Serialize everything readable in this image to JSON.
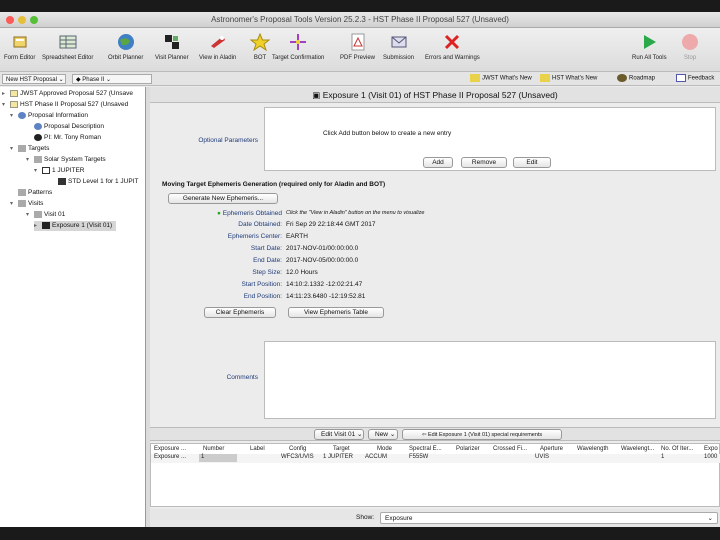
{
  "window": {
    "title": "Astronomer's Proposal Tools Version 25.2.3 - HST Phase II Proposal 527 (Unsaved)"
  },
  "toolbar": {
    "items": [
      {
        "label": "Form Editor",
        "icon": "form-editor-icon"
      },
      {
        "label": "Spreadsheet Editor",
        "icon": "spreadsheet-icon"
      },
      {
        "label": "Orbit Planner",
        "icon": "globe-icon"
      },
      {
        "label": "Visit Planner",
        "icon": "visit-planner-icon"
      },
      {
        "label": "View in Aladin",
        "icon": "aladin-icon"
      },
      {
        "label": "BOT",
        "icon": "star-icon"
      },
      {
        "label": "Target Confirmation",
        "icon": "crosshair-icon"
      },
      {
        "label": "PDF Preview",
        "icon": "pdf-icon"
      },
      {
        "label": "Submission",
        "icon": "submission-icon"
      },
      {
        "label": "Errors and Warnings",
        "icon": "error-x-icon"
      }
    ],
    "run_all": "Run All Tools",
    "stop": "Stop"
  },
  "tabs": {
    "tab1": "New HST Proposal",
    "tab2": "Phase II",
    "links": [
      {
        "label": "JWST What's New",
        "icon": "whats-new-icon"
      },
      {
        "label": "HST What's New",
        "icon": "whats-new-icon"
      },
      {
        "label": "Roadmap",
        "icon": "roadmap-icon"
      },
      {
        "label": "Feedback",
        "icon": "feedback-icon"
      }
    ]
  },
  "tree": {
    "items": [
      {
        "label": "JWST Approved Proposal 527 (Unsave",
        "level": 0,
        "arrow": "▸"
      },
      {
        "label": "HST Phase II Proposal 527 (Unsaved",
        "level": 0,
        "arrow": "▾"
      },
      {
        "label": "Proposal Information",
        "level": 1,
        "arrow": "▾"
      },
      {
        "label": "Proposal Description",
        "level": 2,
        "arrow": ""
      },
      {
        "label": "PI: Mr. Tony Roman",
        "level": 2,
        "arrow": ""
      },
      {
        "label": "Targets",
        "level": 1,
        "arrow": "▾"
      },
      {
        "label": "Solar System Targets",
        "level": 2,
        "arrow": "▾"
      },
      {
        "label": "1 JUPITER",
        "level": 3,
        "arrow": "▾"
      },
      {
        "label": "STD Level 1 for 1 JUPIT",
        "level": 4,
        "arrow": ""
      },
      {
        "label": "Patterns",
        "level": 1,
        "arrow": ""
      },
      {
        "label": "Visits",
        "level": 1,
        "arrow": "▾"
      },
      {
        "label": "Visit 01",
        "level": 2,
        "arrow": "▾"
      },
      {
        "label": "Exposure 1 (Visit 01)",
        "level": 3,
        "arrow": "▸"
      }
    ]
  },
  "main": {
    "header": "Exposure 1 (Visit 01) of HST Phase II Proposal 527 (Unsaved)",
    "optional_parameters_label": "Optional Parameters",
    "params_hint": "Click Add button below to create a new entry",
    "add": "Add",
    "remove": "Remove",
    "edit": "Edit",
    "ephem_section": "Moving Target Ephemeris Generation (required only for Aladin and BOT)",
    "generate": "Generate New Ephemeris...",
    "ephem_obtained_label": "Ephemeris Obtained",
    "ephem_obtained_value": "Click the \"View in Aladin\" button on the menu to visualize",
    "fields": [
      {
        "label": "Date Obtained:",
        "value": "Fri Sep 29 22:18:44 GMT 2017"
      },
      {
        "label": "Ephemeris Center:",
        "value": "EARTH"
      },
      {
        "label": "Start Date:",
        "value": "2017-NOV-01/00:00:00.0"
      },
      {
        "label": "End Date:",
        "value": "2017-NOV-05/00:00:00.0"
      },
      {
        "label": "Step Size:",
        "value": "12.0 Hours"
      },
      {
        "label": "Start Position:",
        "value": "14:10:2.1332 -12:02:21.47"
      },
      {
        "label": "End Position:",
        "value": "14:11:23.6480 -12:19:52.81"
      }
    ],
    "clear": "Clear Ephemeris",
    "view_table": "View Ephemeris Table",
    "comments_label": "Comments"
  },
  "bottom_bar": {
    "edit_visit": "Edit Visit 01",
    "new": "New",
    "special": "Edit Exposure 1 (Visit 01) special requirements"
  },
  "table": {
    "headers": [
      "Exposure ...",
      "Number",
      "Label",
      "Config",
      "Target",
      "Mode",
      "Spectral E...",
      "Polarizer",
      "Crossed Fi...",
      "Aperture",
      "Wavelength",
      "Wavelengt...",
      "No. Of Iter...",
      "Expo"
    ],
    "row": [
      "Exposure ...",
      "1",
      "",
      "WFC3/UVIS",
      "1 JUPITER",
      "ACCUM",
      "F555W",
      "",
      "",
      "UVIS",
      "",
      "",
      "1",
      "1000"
    ]
  },
  "show_bar": {
    "label": "Show:",
    "value": "Exposure"
  }
}
